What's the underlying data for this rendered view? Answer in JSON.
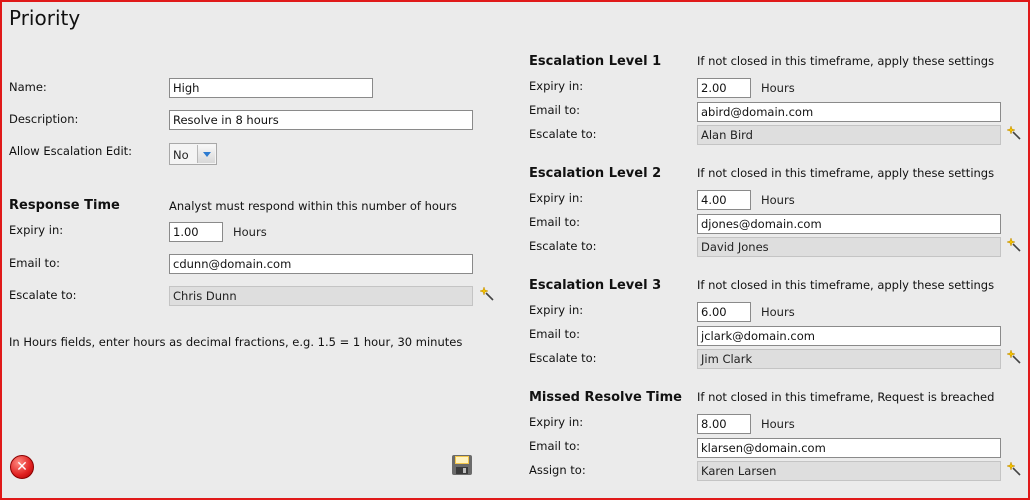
{
  "page": {
    "title": "Priority"
  },
  "form": {
    "name_label": "Name:",
    "name_value": "High",
    "description_label": "Description:",
    "description_value": "Resolve in 8 hours",
    "allow_escalation_label": "Allow Escalation Edit:",
    "allow_escalation_value": "No"
  },
  "response_time": {
    "heading": "Response Time",
    "note": "Analyst must respond within this number of hours",
    "expiry_label": "Expiry in:",
    "expiry_value": "1.00",
    "units": "Hours",
    "email_label": "Email to:",
    "email_value": "cdunn@domain.com",
    "escalate_label": "Escalate to:",
    "escalate_value": "Chris Dunn"
  },
  "hint": "In Hours fields, enter hours as decimal fractions, e.g. 1.5 = 1 hour, 30 minutes",
  "levels": [
    {
      "heading": "Escalation Level 1",
      "note": "If not closed in this timeframe, apply these settings",
      "expiry_label": "Expiry in:",
      "expiry_value": "2.00",
      "units": "Hours",
      "email_label": "Email to:",
      "email_value": "abird@domain.com",
      "escalate_label": "Escalate to:",
      "escalate_value": "Alan Bird"
    },
    {
      "heading": "Escalation Level 2",
      "note": "If not closed in this timeframe, apply these settings",
      "expiry_label": "Expiry in:",
      "expiry_value": "4.00",
      "units": "Hours",
      "email_label": "Email to:",
      "email_value": "djones@domain.com",
      "escalate_label": "Escalate to:",
      "escalate_value": "David Jones"
    },
    {
      "heading": "Escalation Level 3",
      "note": "If not closed in this timeframe, apply these settings",
      "expiry_label": "Expiry in:",
      "expiry_value": "6.00",
      "units": "Hours",
      "email_label": "Email to:",
      "email_value": "jclark@domain.com",
      "escalate_label": "Escalate to:",
      "escalate_value": "Jim Clark"
    },
    {
      "heading": "Missed Resolve Time",
      "note": "If not closed in this timeframe, Request is breached",
      "expiry_label": "Expiry in:",
      "expiry_value": "8.00",
      "units": "Hours",
      "email_label": "Email to:",
      "email_value": "klarsen@domain.com",
      "escalate_label": "Assign to:",
      "escalate_value": "Karen Larsen"
    }
  ],
  "actions": {
    "close_icon": "close-icon",
    "close_glyph": "✕",
    "save_icon": "save-icon",
    "picker_icon": "magic-wand-icon"
  },
  "colors": {
    "frame_border": "#e01919",
    "background": "#ebebeb",
    "dropdown_arrow": "#2d7bd0"
  }
}
